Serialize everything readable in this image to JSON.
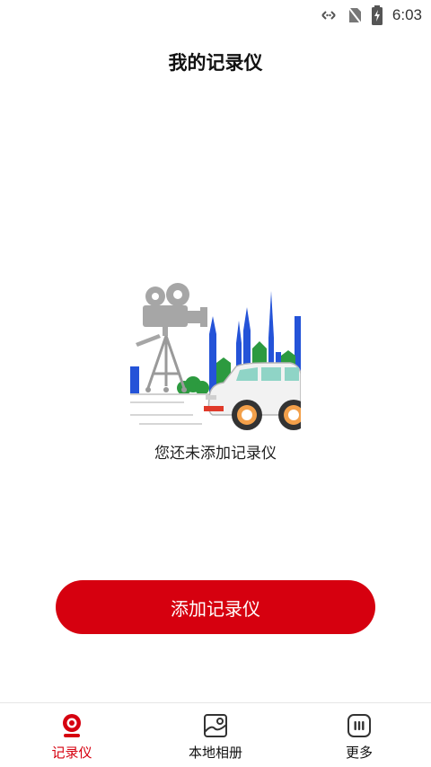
{
  "status_bar": {
    "time": "6:03",
    "icons": [
      "data-transfer-icon",
      "no-sim-icon",
      "battery-charging-icon"
    ]
  },
  "header": {
    "title": "我的记录仪"
  },
  "empty_state": {
    "illustration": "dashcam-car-city-illustration",
    "message": "您还未添加记录仪"
  },
  "actions": {
    "add_button_label": "添加记录仪"
  },
  "bottom_nav": {
    "items": [
      {
        "label": "记录仪",
        "icon": "dashcam-icon",
        "active": true
      },
      {
        "label": "本地相册",
        "icon": "album-icon",
        "active": false
      },
      {
        "label": "更多",
        "icon": "more-icon",
        "active": false
      }
    ]
  },
  "colors": {
    "accent": "#d6000f"
  }
}
